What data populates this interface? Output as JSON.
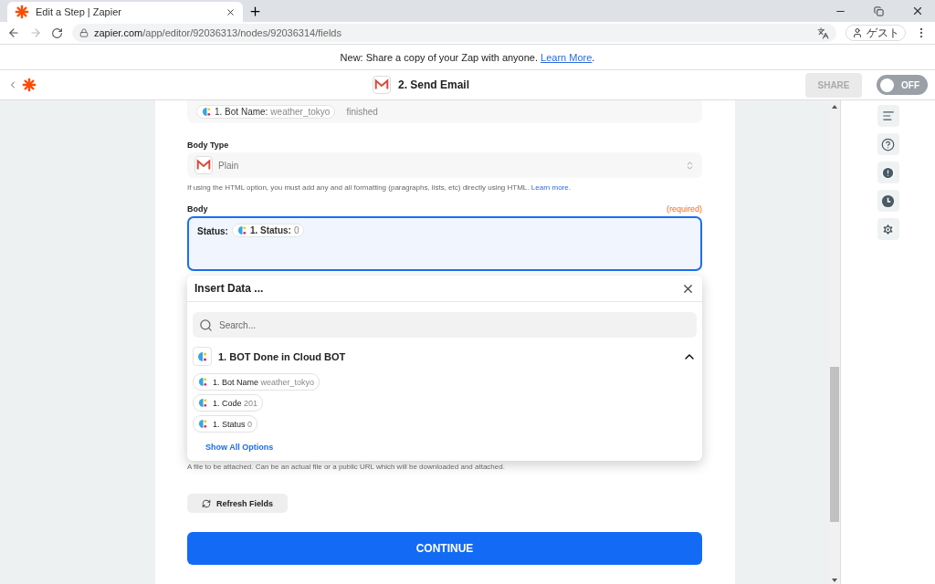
{
  "browser": {
    "tabs": [
      {
        "title": "Edit a Step | Zapier",
        "selected": true
      }
    ],
    "url_host": "zapier.com",
    "url_path": "/app/editor/92036313/nodes/92036314/fields",
    "profile": "ゲスト"
  },
  "banner": {
    "text": "New: Share a copy of your Zap with anyone.",
    "link": "Learn More",
    "tail": "."
  },
  "header": {
    "title": "2. Send Email",
    "share": {
      "label": "SHARE",
      "disabled": true
    },
    "toggle": {
      "label": "OFF",
      "on": false
    }
  },
  "top_field": {
    "chip": {
      "label": "1. Bot Name:",
      "value": "weather_tokyo"
    },
    "text": "finished"
  },
  "body_type": {
    "label": "Body Type",
    "value": "Plain",
    "hint": "If using the HTML option, you must add any and all formatting (paragraphs, lists, etc) directly using HTML.",
    "hint_link": "Learn more."
  },
  "body": {
    "label": "Body",
    "required": "(required)",
    "prefix": "Status:",
    "chip": {
      "label": "1. Status:",
      "value": "0"
    },
    "focused": true
  },
  "insert_data": {
    "title": "Insert Data ...",
    "search_placeholder": "Search...",
    "group": {
      "title": "1. BOT Done in Cloud BOT",
      "expanded": true
    },
    "items": [
      {
        "label": "1. Bot Name",
        "value": "weather_tokyo"
      },
      {
        "label": "1. Code",
        "value": "201"
      },
      {
        "label": "1. Status",
        "value": "0"
      }
    ],
    "show_all": "Show All Options"
  },
  "attachment_hint": "A file to be attached. Can be an actual file or a public URL which will be downloaded and attached.",
  "refresh": "Refresh Fields",
  "continue": "CONTINUE"
}
